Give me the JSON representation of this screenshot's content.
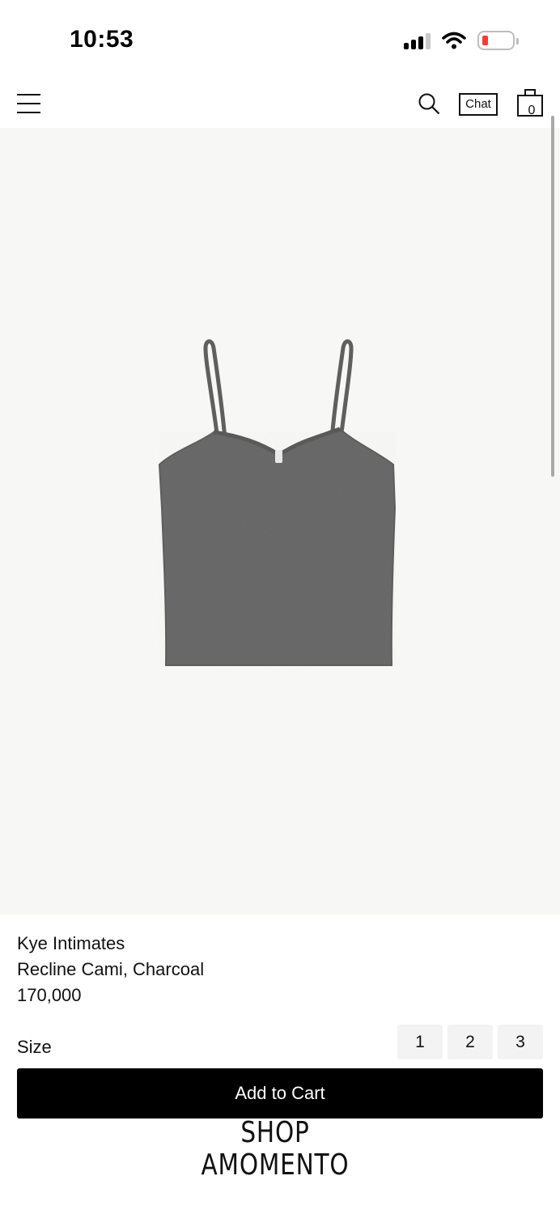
{
  "status_bar": {
    "time": "10:53",
    "battery_color": "#ff3b30"
  },
  "header": {
    "menu_icon": "hamburger-menu-icon",
    "search_icon": "search-icon",
    "chat_label": "Chat",
    "cart_count": "0"
  },
  "product": {
    "brand": "Kye Intimates",
    "name": "Recline Cami, Charcoal",
    "price": "170,000",
    "image_background": "#f7f7f5",
    "garment_color": "#666666"
  },
  "size": {
    "label": "Size",
    "options": [
      "1",
      "2",
      "3"
    ]
  },
  "add_to_cart_label": "Add to Cart",
  "logo": {
    "line1": "SHOP",
    "line2": "AMOMENTO"
  }
}
